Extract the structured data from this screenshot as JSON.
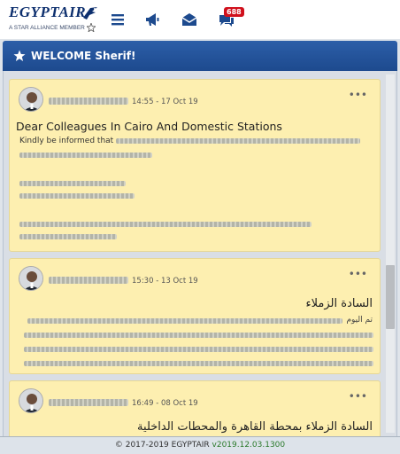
{
  "header": {
    "logo_text": "EGYPTAIR",
    "logo_subtitle": "A STAR ALLIANCE MEMBER",
    "notification_count": "688",
    "icons": [
      "menu-icon",
      "megaphone-icon",
      "mail-icon",
      "chat-icon"
    ]
  },
  "welcome": {
    "text": "WELCOME Sherif!"
  },
  "posts": [
    {
      "time": "14:55 - 17 Oct 19",
      "title": "Dear Colleagues In Cairo And Domestic Stations",
      "body_start": "Kindly be informed that"
    },
    {
      "time": "15:30 - 13 Oct 19",
      "title": "السادة الزملاء",
      "body_start": "تم اليوم"
    },
    {
      "time": "16:49 - 08 Oct 19",
      "title": "السادة الزملاء بمحطة القاهرة والمحطات الداخلية"
    }
  ],
  "footer": {
    "copyright": "© 2017-2019 EGYPTAIR",
    "version": "v2019.12.03.1300"
  },
  "colors": {
    "brand": "#0d2f6e",
    "header_bar": "#1d4a8e",
    "card_bg": "#fdefb0",
    "badge": "#d0101c",
    "version": "#2c7a2c"
  }
}
